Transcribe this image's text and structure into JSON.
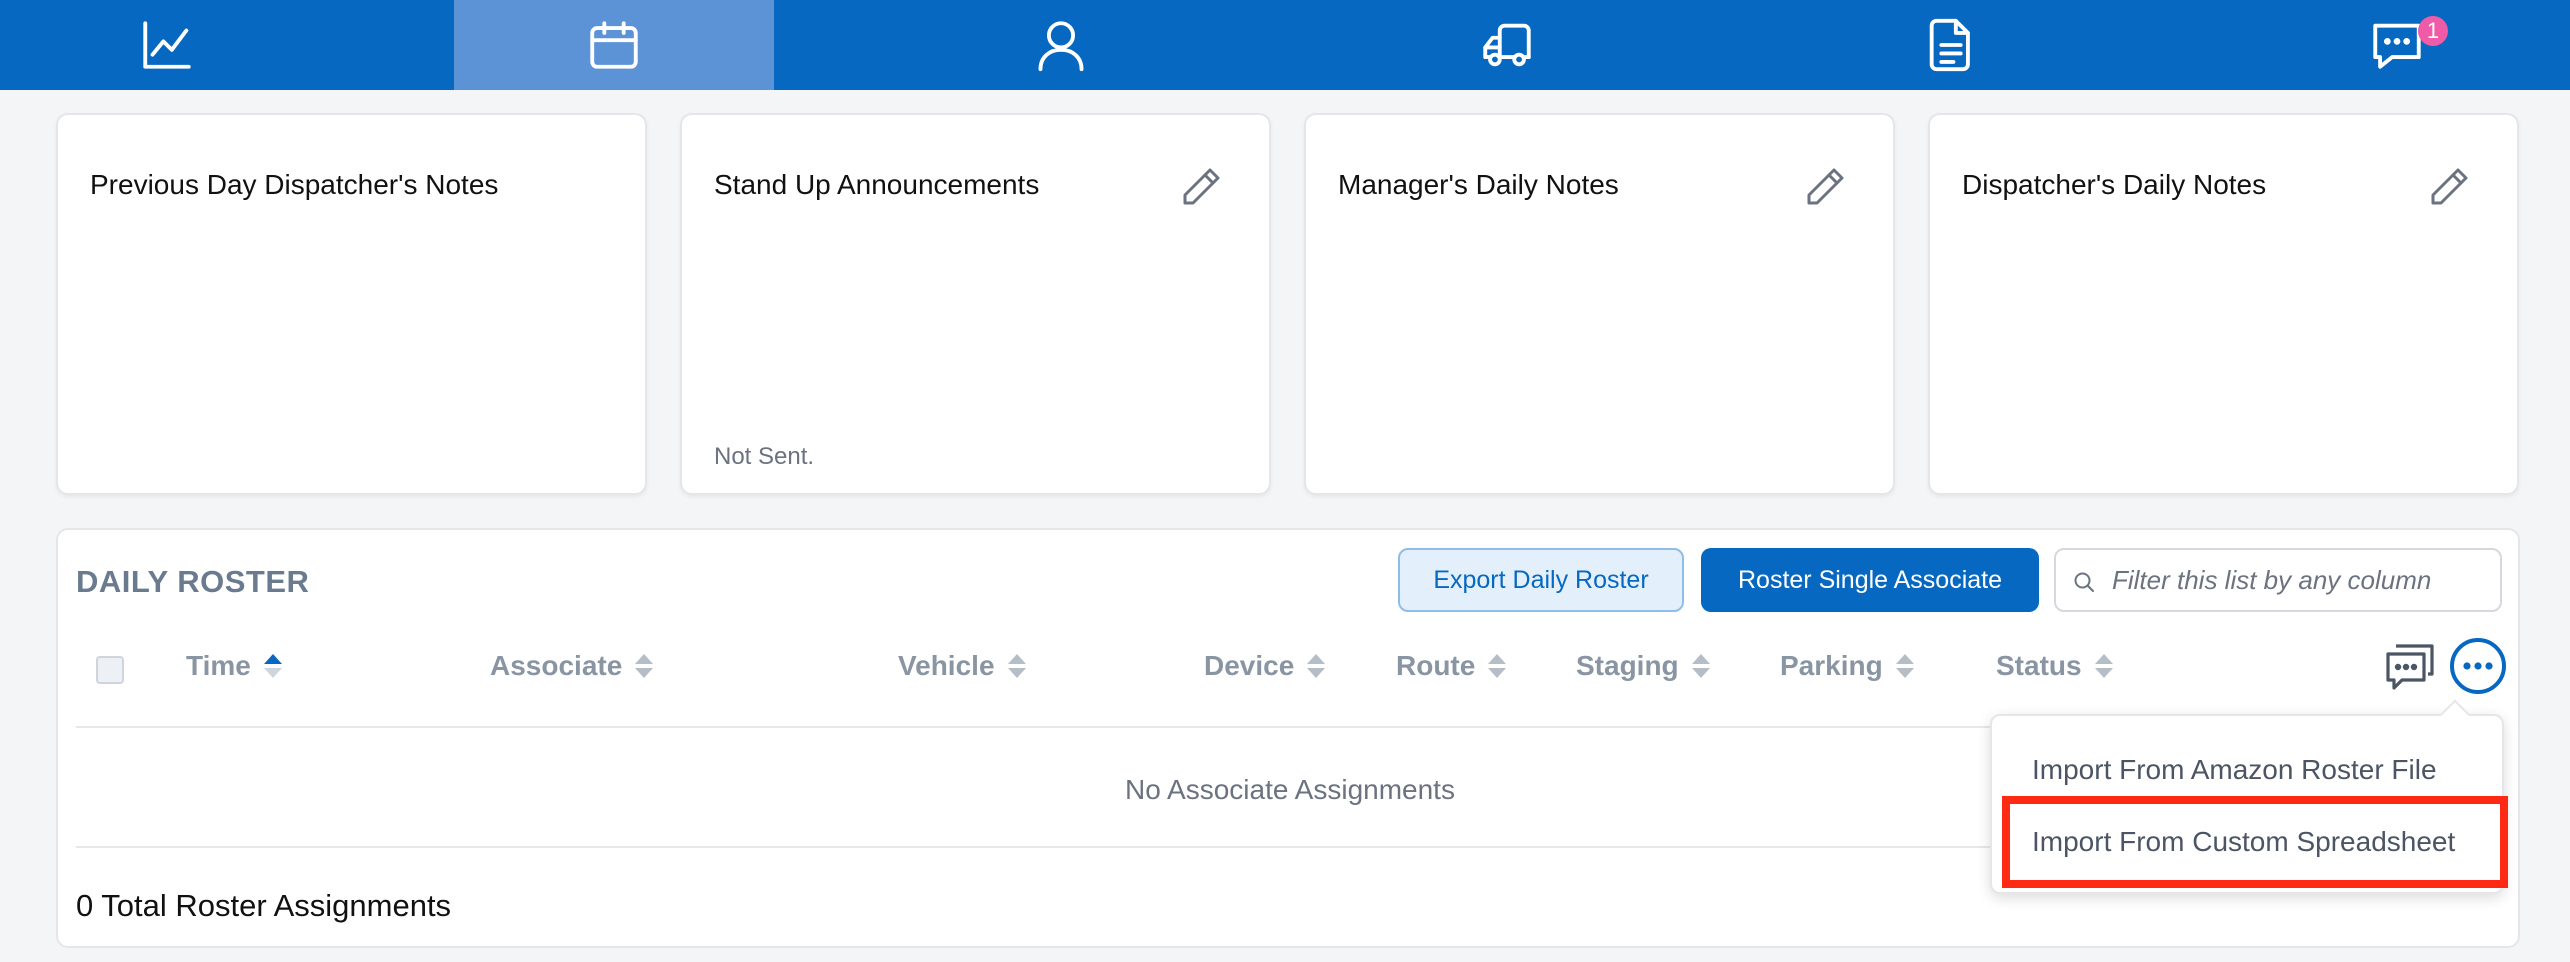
{
  "nav": {
    "items": [
      {
        "icon": "chart-line-icon",
        "active": false
      },
      {
        "icon": "calendar-icon",
        "active": true
      },
      {
        "icon": "user-icon",
        "active": false
      },
      {
        "icon": "truck-icon",
        "active": false
      },
      {
        "icon": "document-icon",
        "active": false
      },
      {
        "icon": "message-icon",
        "active": false,
        "badge": "1"
      }
    ],
    "colors": {
      "bar": "#0768c1",
      "active": "#5b93d6",
      "badge": "#ef5ba6"
    }
  },
  "cards": [
    {
      "title": "Previous Day Dispatcher's Notes",
      "editable": false,
      "status": ""
    },
    {
      "title": "Stand Up Announcements",
      "editable": true,
      "status": "Not Sent."
    },
    {
      "title": "Manager's Daily Notes",
      "editable": true,
      "status": ""
    },
    {
      "title": "Dispatcher's Daily Notes",
      "editable": true,
      "status": ""
    }
  ],
  "roster": {
    "title": "DAILY ROSTER",
    "export_label": "Export Daily Roster",
    "single_label": "Roster Single Associate",
    "filter_placeholder": "Filter this list by any column",
    "filter_value": "",
    "columns": [
      "Time",
      "Associate",
      "Vehicle",
      "Device",
      "Route",
      "Staging",
      "Parking",
      "Status"
    ],
    "sorted_column": "Time",
    "empty_text": "No Associate Assignments",
    "total_text": "0 Total Roster Assignments"
  },
  "menu": {
    "items": [
      "Import From Amazon Roster File",
      "Import From Custom Spreadsheet"
    ],
    "highlighted": "Import From Custom Spreadsheet",
    "highlight_color": "#ff2a13"
  }
}
